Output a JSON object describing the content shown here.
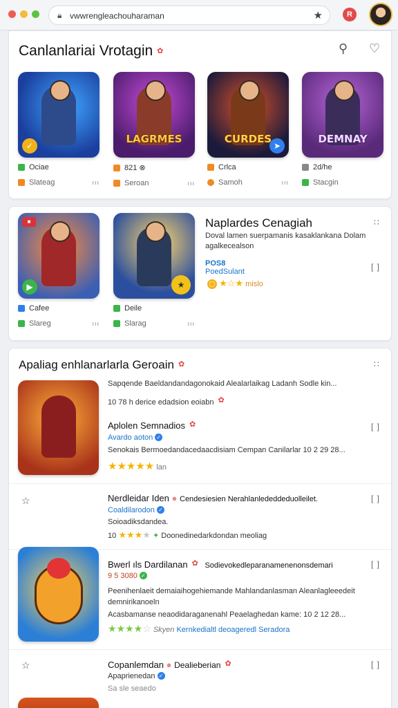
{
  "browser": {
    "url": "vwwrengleachouharaman",
    "lock_icon": "lock-icon",
    "star_icon": "star-icon",
    "ext_badge": "R"
  },
  "section1": {
    "title": "Canlanlariai Vrotagin",
    "tiles": [
      {
        "meta1": "Ociae",
        "meta2": "Slateag",
        "tiny": "ııı",
        "color1": "#3bb54a",
        "color2": "#f08a24",
        "logo": ""
      },
      {
        "meta1": "821 ⊗",
        "meta2": "Seroan",
        "tiny": "ııı",
        "color1": "#f08a24",
        "color2": "#f08a24",
        "logo": "LAGRMES"
      },
      {
        "meta1": "Crlca",
        "meta2": "Samoh",
        "tiny": "ııı",
        "color1": "#f08a24",
        "color2": "#f08a24",
        "logo": "CURDES"
      },
      {
        "meta1": "2d/he",
        "meta2": "Stacgin",
        "tiny": "ııı",
        "color1": "#888888",
        "color2": "#3bb54a",
        "logo": "DEMNAY"
      }
    ]
  },
  "section2": {
    "tiles": [
      {
        "meta1": "Cafee",
        "meta2": "Slareg",
        "tiny": "ııı"
      },
      {
        "meta1": "Deile",
        "meta2": "Slarag",
        "tiny": "ııı"
      }
    ],
    "feature": {
      "title": "Naplardes Cenagiah",
      "desc1": "Doval lamen suerpamanis kasaklankana Dolam",
      "desc2": "agalkecealson",
      "tag1": "POS8",
      "tag2": "PoedSulant",
      "rating_text": "mislo"
    }
  },
  "section3": {
    "title": "Apaliag enhlanarlarla Geroain",
    "top_line1": "Sapqende Baeldandandagonokaid Alealarlaikag Ladanh Sodle kin...",
    "top_line2": "10 78 h derice edadsion eoiabn",
    "items": [
      {
        "title": "Aplolen Semnadios",
        "sub": "Avardo aoton",
        "desc": "Senokais Bermoedandacedaacdisiam Cempan Canilarlar 10 2 29 28...",
        "extra": "lan",
        "star_count": 5
      },
      {
        "title": "Nerdleidar Iden",
        "title2": "Cendesiesien Nerahlanlededdeduolleilet.",
        "sub": "Coaldilarodon",
        "desc": "Soioadiksdandea.",
        "meta": "Doonedinedarkdondan meoliag",
        "rating_num": "10",
        "star_count": 3
      },
      {
        "title": "Bwerl ıls Dardilanan",
        "title2": "Sodievokedleparanamenenonsdemari",
        "sub": "9 5 3080",
        "desc1": "Peenihenlaeit demaiaihogehiemande Mahlandanlasman Aleanlagleeedeit",
        "desc2": "demnirikanoeln",
        "desc3": "Acasbamanse neaodidaraganenahl Peaelaghedan kame: 10 2 12 28...",
        "meta": "Kernkedialtl deoageredl Seradora",
        "extra": "Skyen",
        "star_count": 4
      },
      {
        "title": "Copanlemdan",
        "title2": "Dealieberian",
        "sub": "Apaprienedan",
        "meta": "Sa sle seaedo"
      }
    ]
  }
}
